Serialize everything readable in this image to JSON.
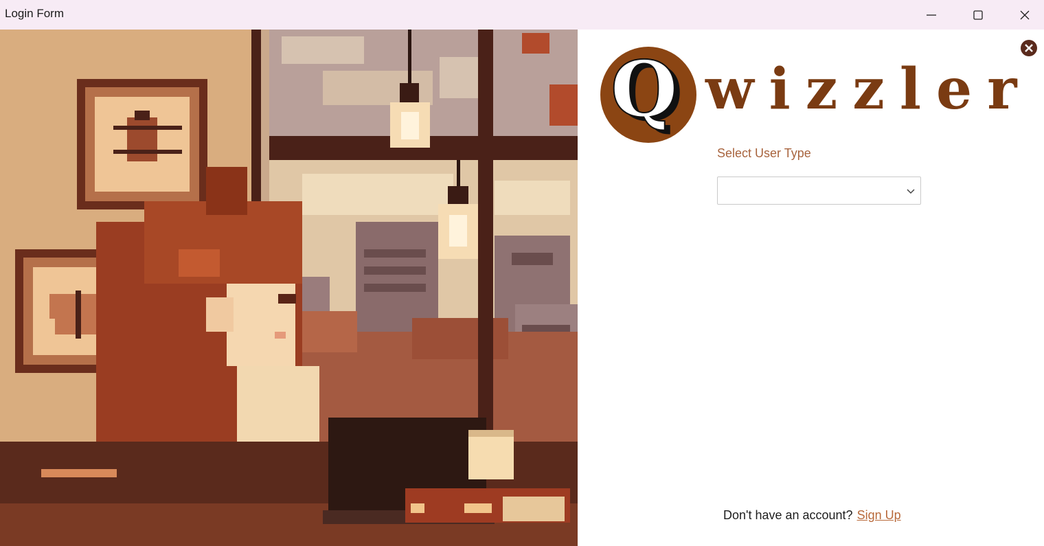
{
  "window": {
    "title": "Login Form",
    "controls": [
      "minimize-icon",
      "maximize-icon",
      "close-icon"
    ]
  },
  "art": {
    "icons": [
      "framed-beetle-icon",
      "framed-butterfly-icon",
      "hanging-bulb-icon"
    ]
  },
  "brand": {
    "logo_letter": "Q",
    "logo_rest": "wizzler",
    "color_dark": "#7a3b12",
    "color_accent": "#b8693a"
  },
  "form": {
    "user_type_label": "Select User Type",
    "user_type_value": ""
  },
  "footer": {
    "prompt": "Don't have an account?",
    "signup_link": "Sign Up"
  }
}
